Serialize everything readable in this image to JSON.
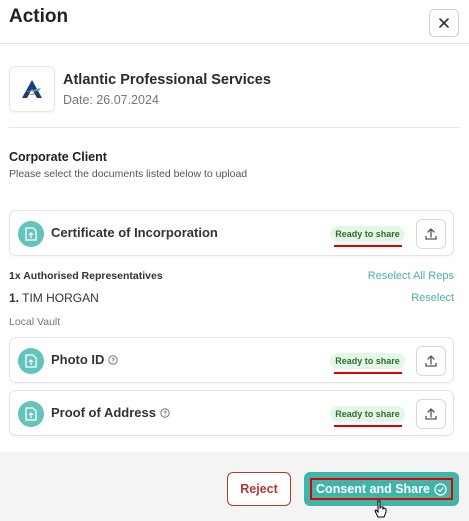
{
  "header": {
    "title": "Action",
    "close_icon": "close-icon"
  },
  "company": {
    "name": "Atlantic Professional Services",
    "date": "Date: 26.07.2024",
    "logo_icon": "company-logo"
  },
  "section": {
    "title": "Corporate Client",
    "subtitle": "Please select the documents listed below to upload"
  },
  "documents": [
    {
      "name": "Certificate of Incorporation",
      "status": "Ready to share",
      "has_help": false
    },
    {
      "name": "Photo ID",
      "status": "Ready to share",
      "has_help": true
    },
    {
      "name": "Proof of Address",
      "status": "Ready to share",
      "has_help": true
    }
  ],
  "reps": {
    "label": "1x Authorised Representatives",
    "reselect_all": "Reselect All Reps",
    "rep_number": "1.",
    "rep_name": "TIM HORGAN",
    "reselect": "Reselect",
    "vault_label": "Local Vault"
  },
  "footer": {
    "reject_label": "Reject",
    "consent_label": "Consent and Share"
  },
  "colors": {
    "accent": "#3fb5aa",
    "badge_bg": "#e4f7e6",
    "badge_text": "#2f6b34",
    "reject": "#b03a2e",
    "highlight": "#e00000"
  }
}
